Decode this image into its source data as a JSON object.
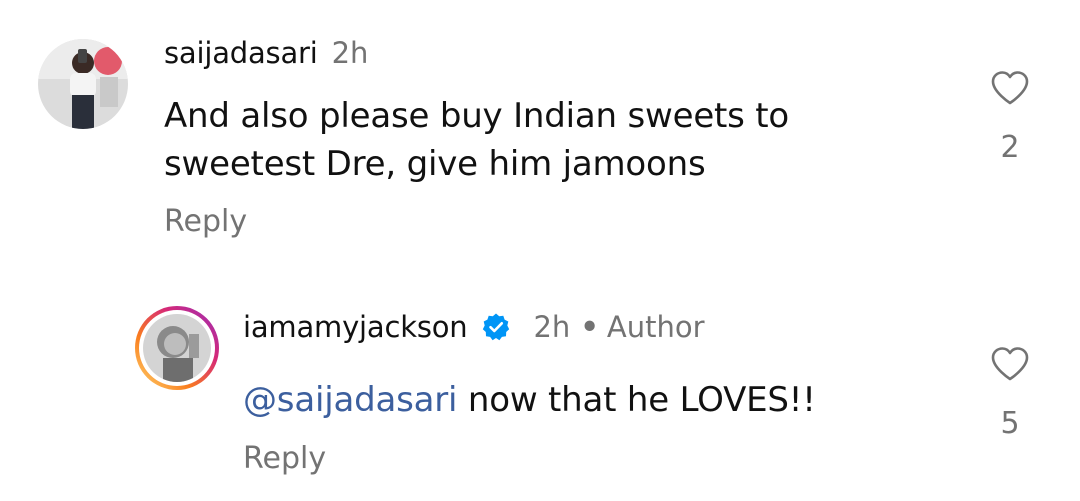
{
  "comments": [
    {
      "username": "saijadasari",
      "time": "2h",
      "text": "And also please buy Indian sweets to sweetest Dre, give him jamoons",
      "reply_label": "Reply",
      "likes": "2"
    },
    {
      "username": "iamamyjackson",
      "verified": true,
      "time": "2h",
      "separator": "•",
      "author_label": "Author",
      "mention": "@saijadasari",
      "text": " now that he LOVES!!",
      "reply_label": "Reply",
      "likes": "5"
    }
  ],
  "colors": {
    "mention": "#3c5f9e",
    "secondary_text": "#737373",
    "verified_badge": "#0095f6",
    "story_ring_start": "#feda75",
    "story_ring_end": "#d62976"
  },
  "icons": [
    "heart-outline-icon",
    "verified-badge-icon"
  ]
}
